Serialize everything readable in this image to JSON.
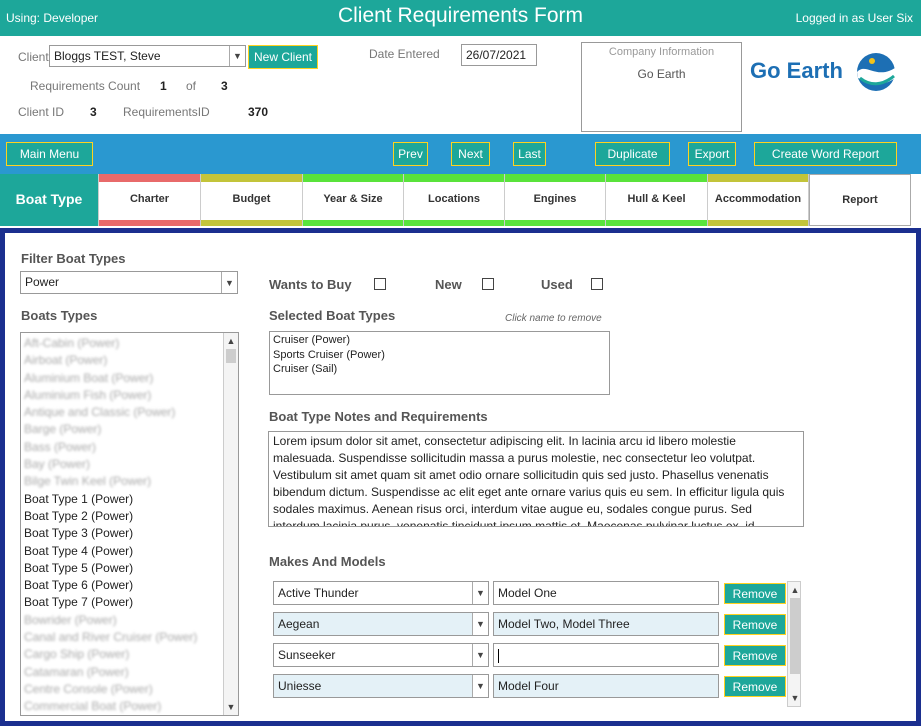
{
  "header": {
    "using": "Using: Developer",
    "title": "Client Requirements Form",
    "logged_in": "Logged in as User Six"
  },
  "client": {
    "label": "Client",
    "value": "Bloggs TEST, Steve",
    "new_client_label": "New Client",
    "req_count_label": "Requirements Count",
    "req_count": "1",
    "of_label": "of",
    "req_total": "3",
    "client_id_label": "Client ID",
    "client_id": "3",
    "requirements_id_label": "RequirementsID",
    "requirements_id": "370",
    "date_label": "Date Entered",
    "date_value": "26/07/2021"
  },
  "company": {
    "heading": "Company Information",
    "name": "Go Earth",
    "logo_text": "Go Earth"
  },
  "toolbar": {
    "main_menu": "Main Menu",
    "prev": "Prev",
    "next": "Next",
    "last": "Last",
    "duplicate": "Duplicate",
    "export": "Export",
    "create_word_report": "Create Word Report"
  },
  "tabs": [
    {
      "label": "Boat Type",
      "top": "#1da79a",
      "bottom": "#1da79a"
    },
    {
      "label": "Charter",
      "top": "#e86a6a",
      "bottom": "#e86a6a"
    },
    {
      "label": "Budget",
      "top": "#c3c43a",
      "bottom": "#c3c43a"
    },
    {
      "label": "Year & Size",
      "top": "#59e33b",
      "bottom": "#59e33b"
    },
    {
      "label": "Locations",
      "top": "#59e33b",
      "bottom": "#59e33b"
    },
    {
      "label": "Engines",
      "top": "#59e33b",
      "bottom": "#59e33b"
    },
    {
      "label": "Hull & Keel",
      "top": "#59e33b",
      "bottom": "#59e33b"
    },
    {
      "label": "Accommodation",
      "top": "#c3c43a",
      "bottom": "#c3c43a"
    },
    {
      "label": "Report",
      "top": "#ffffff",
      "bottom": "#ffffff"
    }
  ],
  "filter": {
    "label": "Filter Boat Types",
    "value": "Power"
  },
  "boat_types": {
    "label": "Boats Types",
    "items": [
      {
        "text": "Aft-Cabin (Power)",
        "blur": true
      },
      {
        "text": "Airboat (Power)",
        "blur": true
      },
      {
        "text": "Aluminium Boat (Power)",
        "blur": true
      },
      {
        "text": "Aluminium Fish (Power)",
        "blur": true
      },
      {
        "text": "Antique and Classic (Power)",
        "blur": true
      },
      {
        "text": "Barge (Power)",
        "blur": true
      },
      {
        "text": "Bass (Power)",
        "blur": true
      },
      {
        "text": "Bay (Power)",
        "blur": true
      },
      {
        "text": "Bilge Twin Keel (Power)",
        "blur": true
      },
      {
        "text": "Boat Type 1 (Power)",
        "blur": false
      },
      {
        "text": "Boat Type 2 (Power)",
        "blur": false
      },
      {
        "text": "Boat Type 3 (Power)",
        "blur": false
      },
      {
        "text": "Boat Type 4 (Power)",
        "blur": false
      },
      {
        "text": "Boat Type 5 (Power)",
        "blur": false
      },
      {
        "text": "Boat Type 6 (Power)",
        "blur": false
      },
      {
        "text": "Boat Type 7 (Power)",
        "blur": false
      },
      {
        "text": "Bowrider (Power)",
        "blur": true
      },
      {
        "text": "Canal and River Cruiser (Power)",
        "blur": true
      },
      {
        "text": "Cargo Ship (Power)",
        "blur": true
      },
      {
        "text": "Catamaran (Power)",
        "blur": true
      },
      {
        "text": "Centre Console (Power)",
        "blur": true
      },
      {
        "text": "Commercial Boat (Power)",
        "blur": true
      }
    ]
  },
  "options": {
    "wants_to_buy": "Wants to Buy",
    "new": "New",
    "used": "Used"
  },
  "selected": {
    "label": "Selected Boat Types",
    "hint": "Click name to remove",
    "items": [
      "Cruiser (Power)",
      "Sports Cruiser (Power)",
      "Cruiser (Sail)"
    ]
  },
  "notes": {
    "label": "Boat Type Notes and Requirements",
    "text": "Lorem ipsum dolor sit amet, consectetur adipiscing elit. In lacinia arcu id libero molestie malesuada. Suspendisse sollicitudin massa a purus molestie, nec consectetur leo volutpat. Vestibulum sit amet quam sit amet odio ornare sollicitudin quis sed justo. Phasellus venenatis bibendum dictum. Suspendisse ac elit eget ante ornare varius quis eu sem. In efficitur ligula quis sodales maximus. Aenean risus orci, interdum vitae augue eu, sodales congue purus. Sed interdum lacinia purus, venenatis tincidunt ipsum mattis et. Maecenas pulvinar luctus ex, id"
  },
  "makes": {
    "label": "Makes And Models",
    "remove_label": "Remove",
    "rows": [
      {
        "make": "Active Thunder",
        "model": "Model One"
      },
      {
        "make": "Aegean",
        "model": "Model Two, Model Three"
      },
      {
        "make": "Sunseeker",
        "model": ""
      },
      {
        "make": "Uniesse",
        "model": "Model Four"
      }
    ]
  }
}
